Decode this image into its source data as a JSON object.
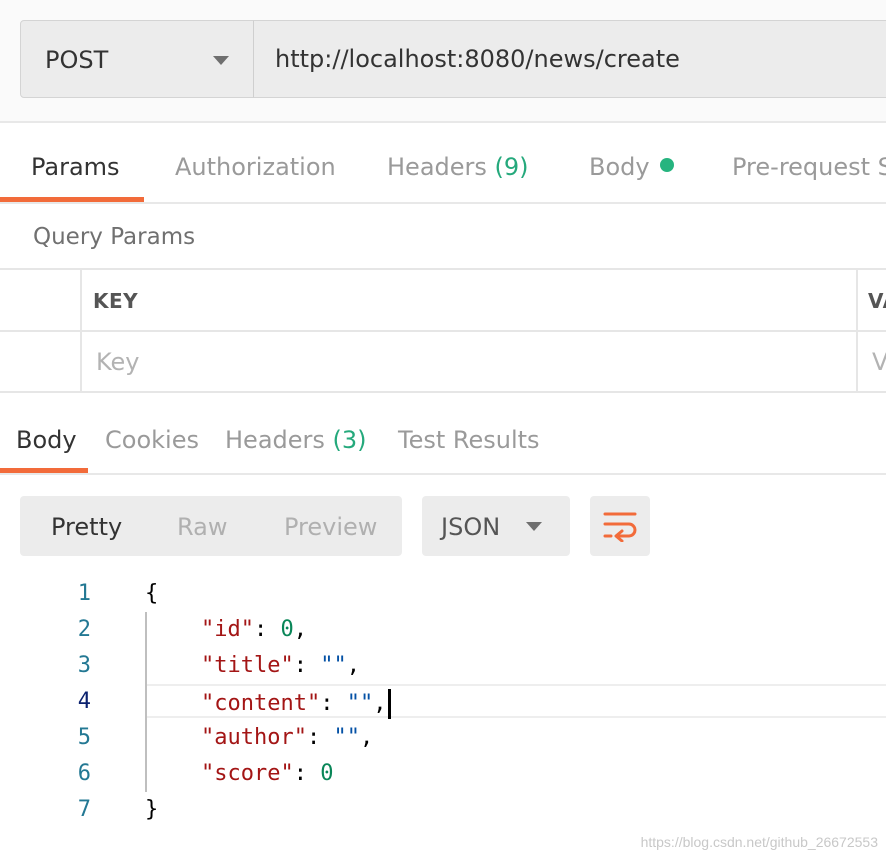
{
  "request": {
    "method": "POST",
    "url": "http://localhost:8080/news/create"
  },
  "request_tabs": [
    {
      "label": "Params",
      "active": true
    },
    {
      "label": "Authorization"
    },
    {
      "label": "Headers",
      "count": "(9)"
    },
    {
      "label": "Body",
      "indicator": "green-dot"
    },
    {
      "label": "Pre-request Sc"
    }
  ],
  "query_params": {
    "title": "Query Params",
    "columns": [
      "KEY",
      "VA"
    ],
    "placeholders": {
      "key": "Key",
      "value": "V"
    }
  },
  "response_tabs": [
    {
      "label": "Body",
      "active": true
    },
    {
      "label": "Cookies"
    },
    {
      "label": "Headers",
      "count": "(3)"
    },
    {
      "label": "Test Results"
    }
  ],
  "view_modes": [
    {
      "label": "Pretty",
      "active": true
    },
    {
      "label": "Raw"
    },
    {
      "label": "Preview"
    }
  ],
  "format": {
    "selected": "JSON"
  },
  "wrap_icon": "wrap-lines-icon",
  "code": {
    "line_numbers": [
      "1",
      "2",
      "3",
      "4",
      "5",
      "6",
      "7"
    ],
    "open_brace": "{",
    "close_brace": "}",
    "fields": [
      {
        "key": "\"id\"",
        "value": "0",
        "type": "number",
        "trail": ","
      },
      {
        "key": "\"title\"",
        "value": "\"\"",
        "type": "string",
        "trail": ","
      },
      {
        "key": "\"content\"",
        "value": "\"\"",
        "type": "string",
        "trail": ","
      },
      {
        "key": "\"author\"",
        "value": "\"\"",
        "type": "string",
        "trail": ","
      },
      {
        "key": "\"score\"",
        "value": "0",
        "type": "number",
        "trail": ""
      }
    ]
  },
  "colors": {
    "accent": "#f26b3a",
    "count_green": "#25a97c",
    "json_key": "#a31515",
    "json_number": "#098658",
    "json_string": "#0451a5",
    "line_number": "#237893"
  },
  "watermark": "https://blog.csdn.net/github_26672553"
}
